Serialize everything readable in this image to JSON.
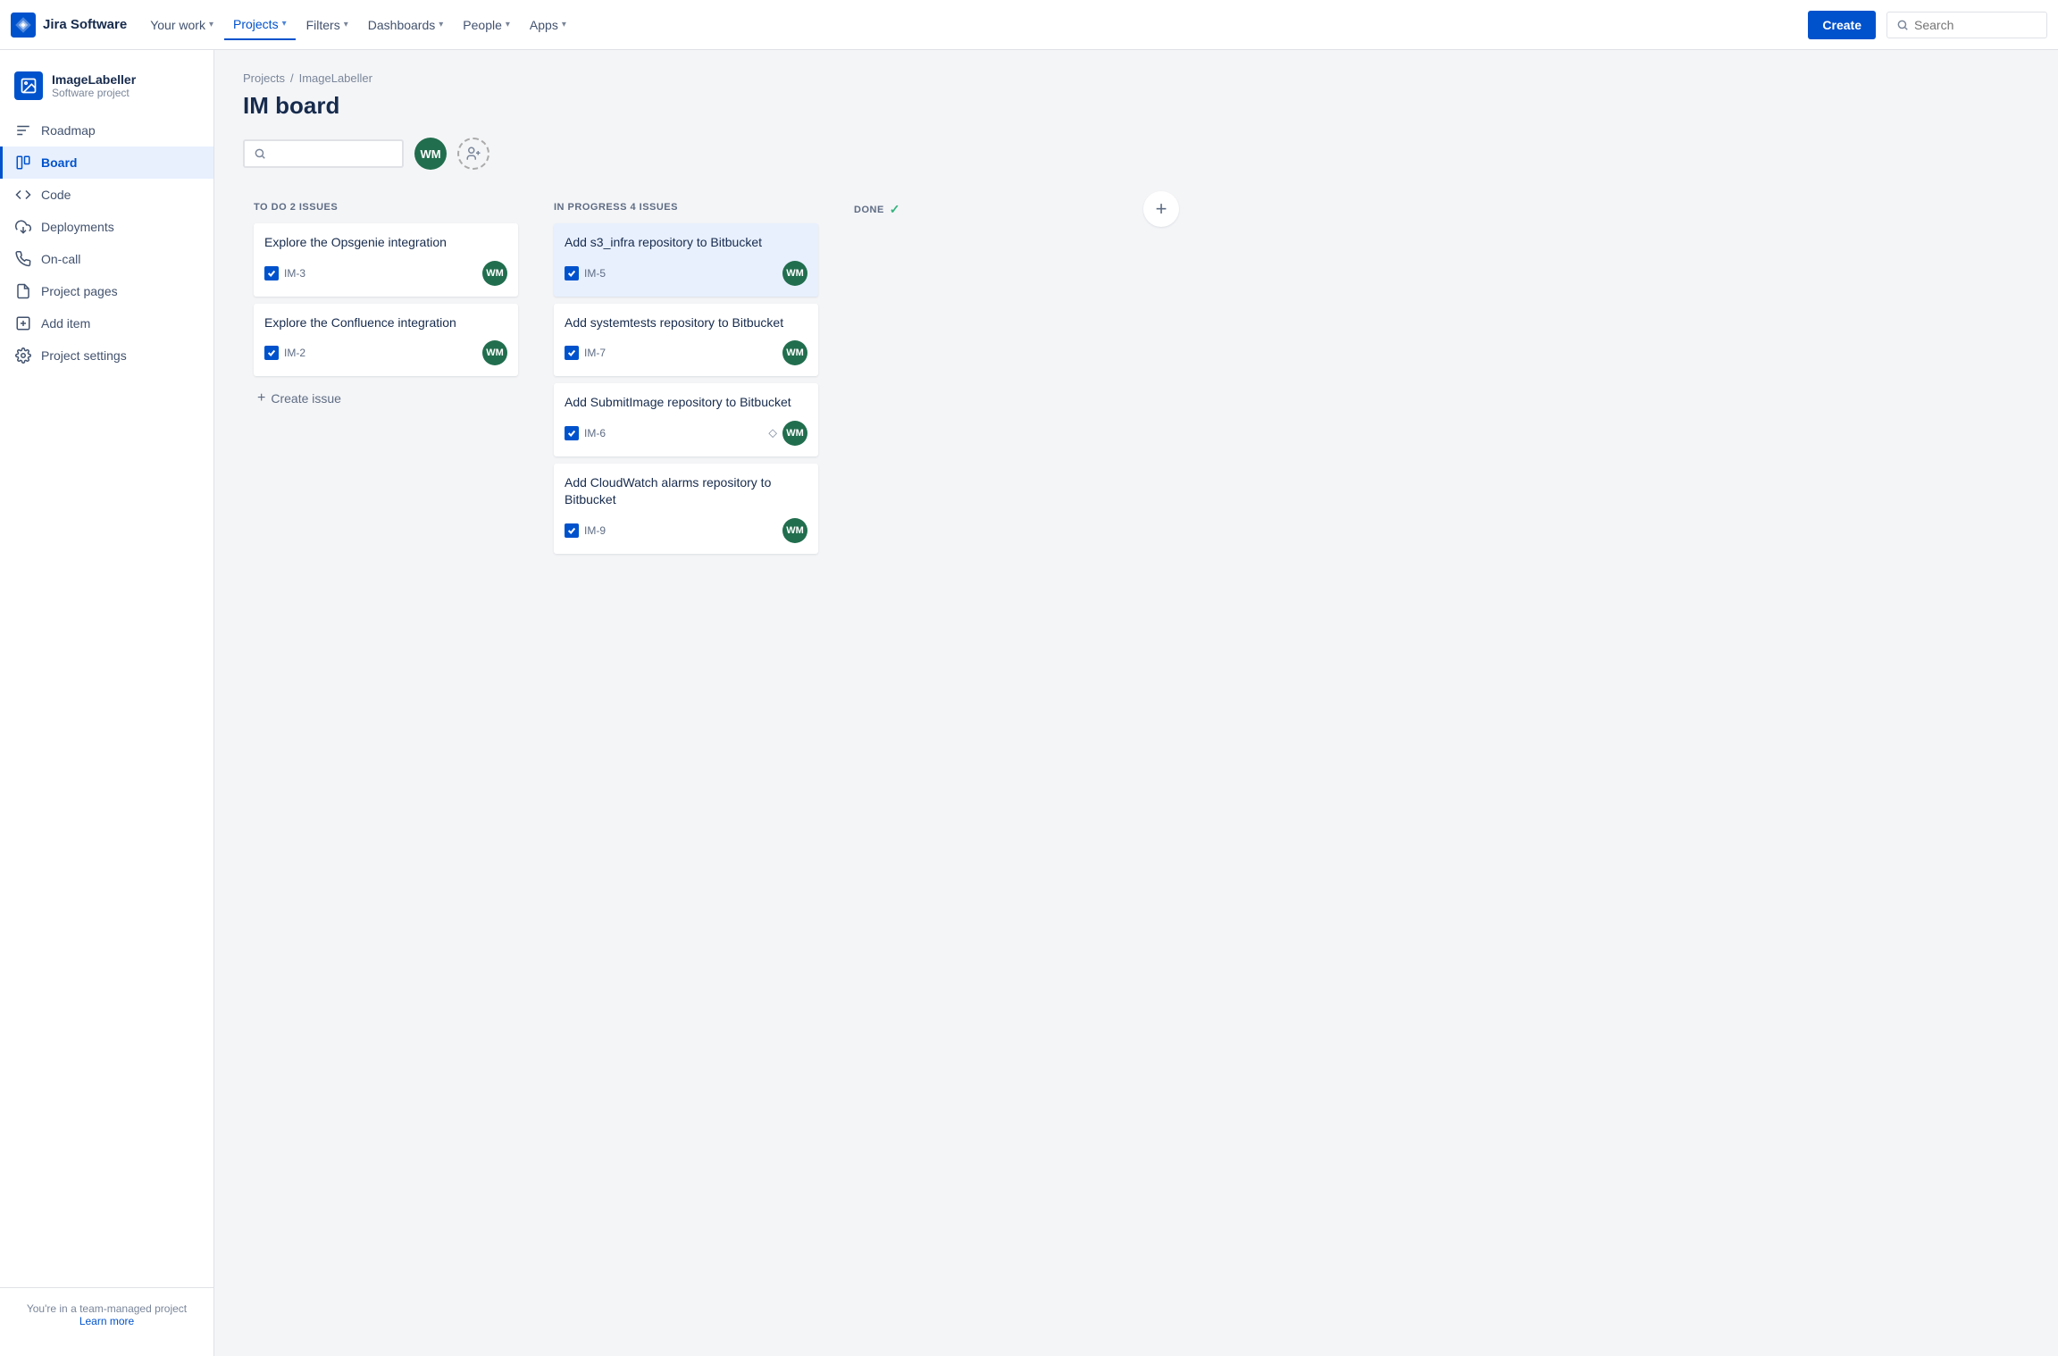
{
  "app": {
    "name": "Jira Software",
    "logo_text": "Jira Software"
  },
  "topnav": {
    "items": [
      {
        "label": "Your work",
        "has_chevron": true,
        "active": false
      },
      {
        "label": "Projects",
        "has_chevron": true,
        "active": true
      },
      {
        "label": "Filters",
        "has_chevron": true,
        "active": false
      },
      {
        "label": "Dashboards",
        "has_chevron": true,
        "active": false
      },
      {
        "label": "People",
        "has_chevron": true,
        "active": false
      },
      {
        "label": "Apps",
        "has_chevron": true,
        "active": false
      }
    ],
    "create_label": "Create",
    "search_placeholder": "Search"
  },
  "sidebar": {
    "project_name": "ImageLabeller",
    "project_type": "Software project",
    "items": [
      {
        "id": "roadmap",
        "label": "Roadmap",
        "icon": "📍",
        "active": false
      },
      {
        "id": "board",
        "label": "Board",
        "icon": "▦",
        "active": true
      },
      {
        "id": "code",
        "label": "Code",
        "icon": "</>",
        "active": false
      },
      {
        "id": "deployments",
        "label": "Deployments",
        "icon": "⬆",
        "active": false
      },
      {
        "id": "oncall",
        "label": "On-call",
        "icon": "📞",
        "active": false
      },
      {
        "id": "project-pages",
        "label": "Project pages",
        "icon": "📄",
        "active": false
      },
      {
        "id": "add-item",
        "label": "Add item",
        "icon": "+",
        "active": false
      },
      {
        "id": "project-settings",
        "label": "Project settings",
        "icon": "⚙",
        "active": false
      }
    ],
    "footer_text": "You're in a team-managed project",
    "footer_link": "Learn more"
  },
  "breadcrumb": {
    "items": [
      "Projects",
      "ImageLabeller"
    ]
  },
  "page": {
    "title": "IM board"
  },
  "board": {
    "search_placeholder": "",
    "avatars": [
      {
        "initials": "WM",
        "color": "#216e4e"
      },
      {
        "initials": "+",
        "color": "none"
      }
    ],
    "columns": [
      {
        "id": "todo",
        "header": "TO DO 2 ISSUES",
        "cards": [
          {
            "id": "IM-3",
            "title": "Explore the Opsgenie integration",
            "highlighted": false,
            "avatar_initials": "WM",
            "avatar_color": "#216e4e",
            "priority_icon": null
          },
          {
            "id": "IM-2",
            "title": "Explore the Confluence integration",
            "highlighted": false,
            "avatar_initials": "WM",
            "avatar_color": "#216e4e",
            "priority_icon": null
          }
        ],
        "create_label": "Create issue"
      },
      {
        "id": "inprogress",
        "header": "IN PROGRESS 4 ISSUES",
        "cards": [
          {
            "id": "IM-5",
            "title": "Add s3_infra repository to Bitbucket",
            "highlighted": true,
            "avatar_initials": "WM",
            "avatar_color": "#216e4e",
            "priority_icon": null
          },
          {
            "id": "IM-7",
            "title": "Add systemtests repository to Bitbucket",
            "highlighted": false,
            "avatar_initials": "WM",
            "avatar_color": "#216e4e",
            "priority_icon": null
          },
          {
            "id": "IM-6",
            "title": "Add SubmitImage repository to Bitbucket",
            "highlighted": false,
            "avatar_initials": "WM",
            "avatar_color": "#216e4e",
            "priority_icon": "⬦"
          },
          {
            "id": "IM-9",
            "title": "Add CloudWatch alarms repository to Bitbucket",
            "highlighted": false,
            "avatar_initials": "WM",
            "avatar_color": "#216e4e",
            "priority_icon": null
          }
        ],
        "create_label": null
      },
      {
        "id": "done",
        "header": "DONE",
        "done_check": "✓",
        "cards": [],
        "create_label": null
      }
    ],
    "add_column_icon": "+"
  }
}
